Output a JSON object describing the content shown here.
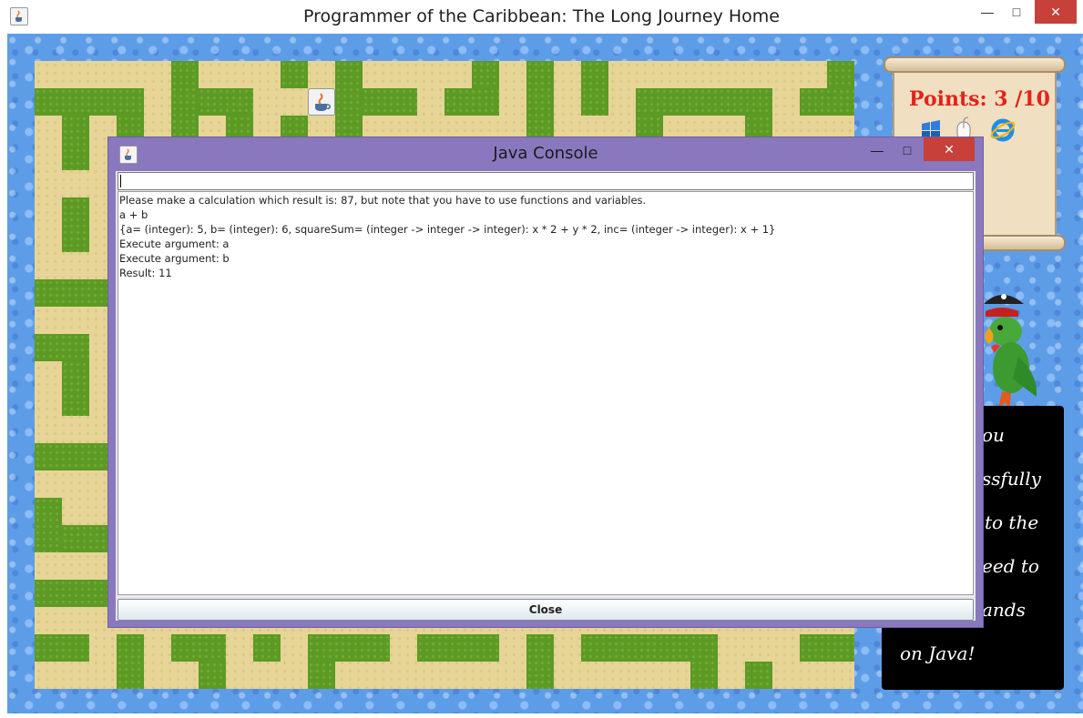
{
  "window": {
    "title": "Programmer of the Caribbean: The Long Journey Home",
    "icon": "java-cup-icon",
    "controls": {
      "minimize": "—",
      "maximize": "□",
      "close": "✕"
    }
  },
  "hud": {
    "points_label": "Points: 3 /10",
    "icons": [
      "windows-flag-icon",
      "mouse-icon",
      "internet-explorer-icon"
    ]
  },
  "message_panel": {
    "visible_fragments": [
      "ou",
      "ssfully",
      "to the",
      "eed to",
      "ands",
      "on Java!"
    ]
  },
  "console": {
    "title": "Java Console",
    "icon": "java-cup-icon",
    "controls": {
      "minimize": "—",
      "maximize": "□",
      "close": "✕"
    },
    "input_value": "",
    "output_lines": [
      "Please make a calculation which result is: 87, but note that you have to use functions and variables.",
      "a + b",
      "{a= (integer): 5, b= (integer): 6, squareSum= (integer -> integer -> integer): x * 2 + y * 2, inc= (integer -> integer): x + 1}",
      "Execute argument: a",
      "Execute argument: b",
      "Result: 11"
    ],
    "close_button_label": "Close"
  },
  "colors": {
    "water": "#5d9de8",
    "sand": "#e6d596",
    "grass": "#5c9a25",
    "dialog_frame": "#8a78bf",
    "points_text": "#e3231b",
    "close_red": "#c7403a"
  }
}
